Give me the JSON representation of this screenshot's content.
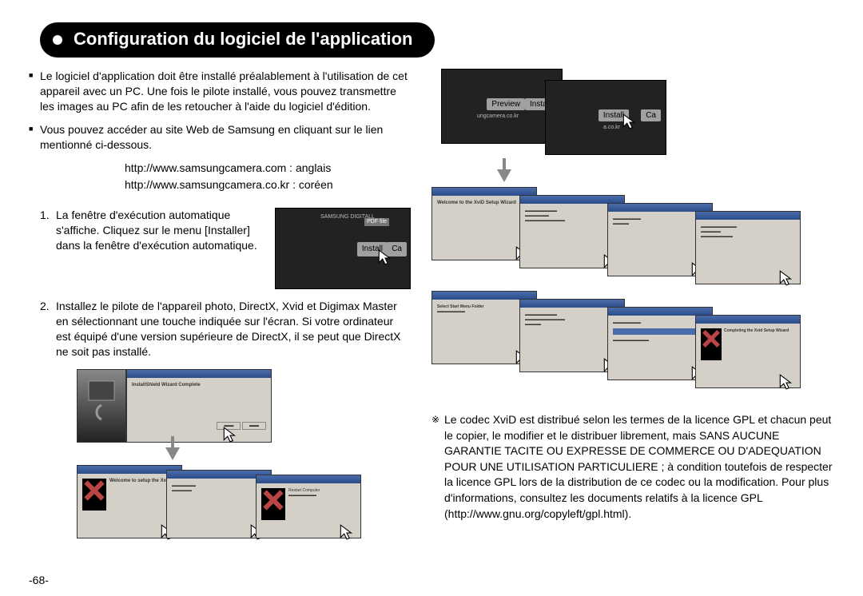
{
  "title": "Configuration du logiciel de l'application",
  "bullets": [
    "Le logiciel d'application doit être installé préalablement à l'utilisation de cet appareil avec un PC. Une fois le pilote installé, vous pouvez transmettre les images au PC afin de les retoucher à l'aide du logiciel d'édition.",
    "Vous pouvez accéder au site Web de Samsung en cliquant sur le lien mentionné ci-dessous."
  ],
  "urls": {
    "line1": "http://www.samsungcamera.com : anglais",
    "line2": "http://www.samsungcamera.co.kr : coréen"
  },
  "step1": {
    "num": "1.",
    "text": "La fenêtre d'exécution automatique s'affiche.  Cliquez sur le menu [Installer] dans la fenêtre d'exécution automatique."
  },
  "step2": {
    "num": "2.",
    "text": "Installez le pilote de l'appareil photo, DirectX, Xvid et Digimax Master en sélectionnant une touche indiquée sur l'écran. Si votre ordinateur est équipé d'une version supérieure de DirectX, il se peut que DirectX ne soit pas installé."
  },
  "thumbs": {
    "brand": "SAMSUNG DIGITALL",
    "pdf": "PDF file",
    "install": "Install",
    "cancel": "Ca",
    "preview": "Preview",
    "url": "ungcamera.co.kr",
    "url2": "a.co.kr",
    "wizard_complete": "InstallShield Wizard Complete",
    "xvid_title": "Welcome to setup the XviD",
    "xvid_complete": "Completing the Xvid Setup Wizard"
  },
  "note": {
    "symbol": "※",
    "text": "Le codec XviD est distribué selon les termes de la licence GPL et chacun peut le copier, le modifier et le distribuer librement, mais SANS AUCUNE GARANTIE TACITE OU EXPRESSE DE COMMERCE OU D'ADEQUATION POUR UNE UTILISATION PARTICULIERE ; à condition toutefois de respecter la licence GPL lors de la distribution de ce codec ou la modification. Pour plus d'informations, consultez les documents relatifs à la licence GPL (http://www.gnu.org/copyleft/gpl.html)."
  },
  "page_number": "-68-"
}
